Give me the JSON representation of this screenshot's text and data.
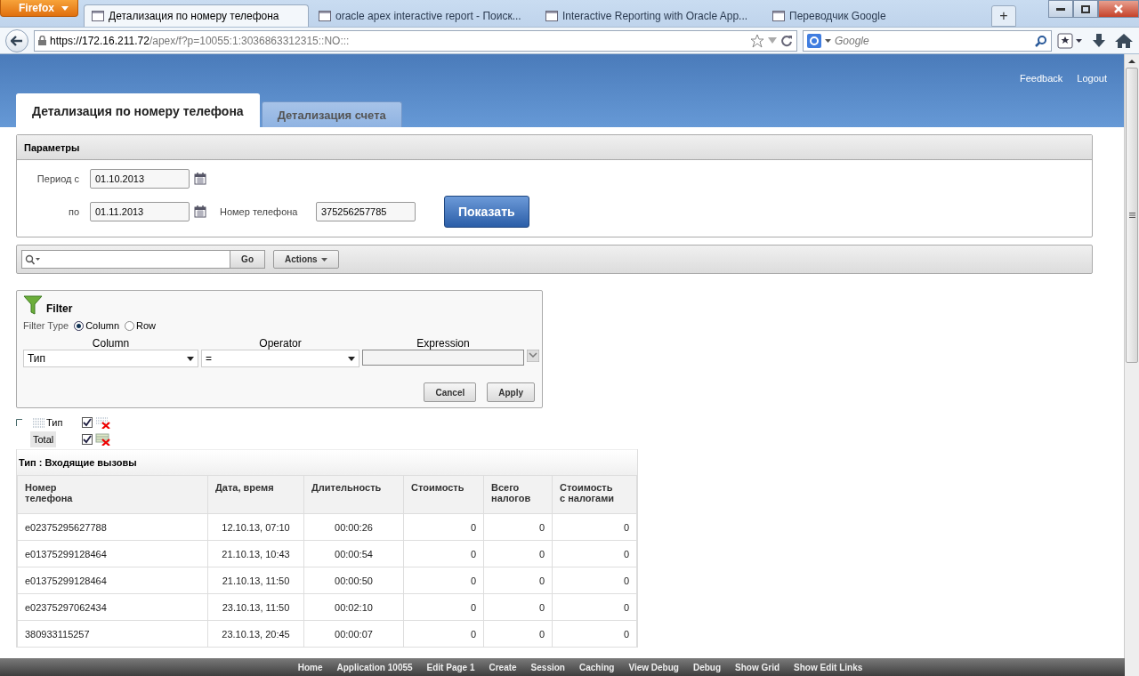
{
  "browser": {
    "menu_button": "Firefox",
    "tabs": [
      {
        "title": "Детализация по номеру телефона",
        "selected": true
      },
      {
        "title": "oracle apex interactive report - Поиск...",
        "selected": false
      },
      {
        "title": "Interactive Reporting with Oracle App...",
        "selected": false
      },
      {
        "title": "Переводчик Google",
        "selected": false
      }
    ],
    "new_tab": "+",
    "url_host": "https://172.16.211.72",
    "url_path": "/apex/f?p=10055:1:3036863312315::NO:::",
    "search_placeholder": "Google"
  },
  "header_links": [
    "Feedback",
    "Logout"
  ],
  "page_tabs": [
    {
      "label": "Детализация по номеру телефона",
      "selected": true
    },
    {
      "label": "Детализация счета",
      "selected": false
    }
  ],
  "parameters": {
    "title": "Параметры",
    "period_from_label": "Период с",
    "period_from": "01.10.2013",
    "period_to_label": "по",
    "period_to": "01.11.2013",
    "phone_label": "Номер телефона",
    "phone": "375256257785",
    "show_button": "Показать"
  },
  "search_bar": {
    "go_button": "Go",
    "actions_button": "Actions"
  },
  "filter": {
    "title": "Filter",
    "type_label": "Filter Type",
    "types": [
      {
        "label": "Column",
        "selected": true
      },
      {
        "label": "Row",
        "selected": false
      }
    ],
    "column_header": "Column",
    "operator_header": "Operator",
    "expression_header": "Expression",
    "column_value": "Тип",
    "operator_value": "=",
    "buttons": [
      "Cancel",
      "Apply"
    ]
  },
  "control_break": [
    {
      "kind": "break",
      "label": "Тип",
      "checked": true
    },
    {
      "kind": "total",
      "label": "Total",
      "checked": true
    }
  ],
  "report": {
    "group_title": "Тип : Входящие вызовы",
    "columns": [
      "Номер\nтелефона",
      "Дата, время",
      "Длительность",
      "Стоимость",
      "Всего\nналогов",
      "Стоимость\nс налогами"
    ],
    "rows": [
      [
        "e02375295627788",
        "12.10.13, 07:10",
        "00:00:26",
        "0",
        "0",
        "0"
      ],
      [
        "e01375299128464",
        "21.10.13, 10:43",
        "00:00:54",
        "0",
        "0",
        "0"
      ],
      [
        "e01375299128464",
        "21.10.13, 11:50",
        "00:00:50",
        "0",
        "0",
        "0"
      ],
      [
        "e02375297062434",
        "23.10.13, 11:50",
        "00:02:10",
        "0",
        "0",
        "0"
      ],
      [
        "380933115257",
        "23.10.13, 20:45",
        "00:00:07",
        "0",
        "0",
        "0"
      ]
    ]
  },
  "dev_toolbar": [
    "Home",
    "Application 10055",
    "Edit Page 1",
    "Create",
    "Session",
    "Caching",
    "View Debug",
    "Debug",
    "Show Grid",
    "Show Edit Links"
  ]
}
